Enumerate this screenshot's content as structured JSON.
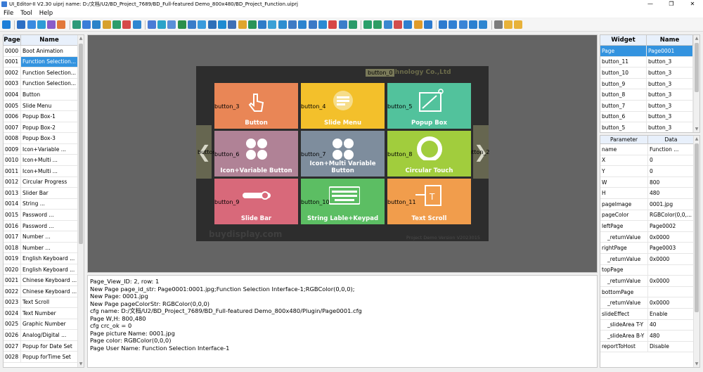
{
  "window": {
    "title": "UI_Editor-II V2.30    uiprj name: D:/文档/U2/BD_Project_7689/BD_Full-featured Demo_800x480/BD_Project_Function.uiprj",
    "minimize": "—",
    "maximize": "❐",
    "close": "✕"
  },
  "menu": [
    "File",
    "Tool",
    "Help"
  ],
  "toolbar": {
    "icons": [
      "search-icon",
      "page-icon",
      "page-add-icon",
      "page-copy-icon",
      "image-icon",
      "color-icon",
      "text-icon",
      "table-icon",
      "grid-icon",
      "grid2-icon",
      "grid3-icon",
      "calendar-icon",
      "save-icon",
      "list-icon",
      "image2-icon",
      "slider-icon",
      "time-icon",
      "keyboard-icon",
      "clock-icon",
      "bell-icon",
      "car-icon",
      "print-icon",
      "chart-icon",
      "menu-icon",
      "circle-icon",
      "wave-icon",
      "globe-icon",
      "compass-icon",
      "picture-icon",
      "mic-icon",
      "timer-icon",
      "video-icon",
      "camera-icon",
      "align-left-icon",
      "align-top-icon",
      "align-bottom-icon",
      "align-right-icon",
      "distribute-icon",
      "align-center-icon",
      "fit-icon",
      "zoom-in-icon",
      "zoom-out-icon",
      "frame-icon",
      "layout-icon",
      "edit-icon",
      "copy-icon",
      "delete-icon",
      "undo-icon",
      "redo-icon"
    ],
    "colors": [
      "#1e7fd8",
      "#2c6fc4",
      "#3a8be0",
      "#2f9bd6",
      "#8a5cc9",
      "#e2783a",
      "#2c9a7a",
      "#3b7dd8",
      "#2a83c9",
      "#d7a12e",
      "#2b9d6b",
      "#d64a4a",
      "#2f86d1",
      "#4a7bd6",
      "#2aa3c9",
      "#5a8fd8",
      "#2b8f4a",
      "#3a7dc9",
      "#3a9bdc",
      "#2d6fb8",
      "#1f8bd1",
      "#3f6fb5",
      "#e0a52c",
      "#2a9458",
      "#2f7cc8",
      "#3aa0d6",
      "#2d8ed0",
      "#3e7bc4",
      "#2b84cf",
      "#3a79c6",
      "#2b8ad3",
      "#d74646",
      "#3a7dc9",
      "#2a9b6a",
      "#2aa06b",
      "#2f9d64",
      "#3a88d0",
      "#d24d4d",
      "#2d7fd0",
      "#e09b2a",
      "#2d7bcf",
      "#2d7bcf",
      "#3180d3",
      "#3a84d6",
      "#2a7fd0",
      "#2f86d1",
      "#7d7d7d",
      "#e8b23a",
      "#e8b23a"
    ]
  },
  "pages": {
    "headers": [
      "Page",
      "Name"
    ],
    "rows": [
      [
        "0000",
        "Boot Animation"
      ],
      [
        "0001",
        "Function Selection..."
      ],
      [
        "0002",
        "Function Selection..."
      ],
      [
        "0003",
        "Function Selection..."
      ],
      [
        "0004",
        "Button"
      ],
      [
        "0005",
        "Slide Menu"
      ],
      [
        "0006",
        "Popup  Box-1"
      ],
      [
        "0007",
        "Popup  Box-2"
      ],
      [
        "0008",
        "Popup  Box-3"
      ],
      [
        "0009",
        "Icon+Variable ..."
      ],
      [
        "0010",
        "Icon+Multi ..."
      ],
      [
        "0011",
        "Icon+Multi ..."
      ],
      [
        "0012",
        "Circular Progress"
      ],
      [
        "0013",
        "Slider Bar"
      ],
      [
        "0014",
        "String ..."
      ],
      [
        "0015",
        "Password ..."
      ],
      [
        "0016",
        "Password ..."
      ],
      [
        "0017",
        "Number ..."
      ],
      [
        "0018",
        "Number ..."
      ],
      [
        "0019",
        "English Keyboard ..."
      ],
      [
        "0020",
        "English Keyboard ..."
      ],
      [
        "0021",
        "Chinese Keyboard ..."
      ],
      [
        "0022",
        "Chinese Keyboard ..."
      ],
      [
        "0023",
        "Text Scroll"
      ],
      [
        "0024",
        "Text Number"
      ],
      [
        "0025",
        "Graphic Number"
      ],
      [
        "0026",
        "Analog/Digital ..."
      ],
      [
        "0027",
        "Popup for Date Set"
      ],
      [
        "0028",
        "Popup forTime Set"
      ]
    ],
    "selected_index": 1
  },
  "preview": {
    "bg_company_text": "sing Technology Co.,Ltd",
    "button_0": "button_0",
    "watermark": "buydisplay.com",
    "version": "Project Demo Version V2023015",
    "left_arrow": "❮",
    "right_arrow": "❯",
    "left_arrow_button": "button_1",
    "right_arrow_button": "button_2",
    "tiles": [
      {
        "button": "button_3",
        "label": "Button",
        "color": "#e98656"
      },
      {
        "button": "button_4",
        "label": "Slide Menu",
        "color": "#f3c02b"
      },
      {
        "button": "button_5",
        "label": "Popup Box",
        "color": "#52c29c"
      },
      {
        "button": "button_6",
        "label": "Icon+Variable Button",
        "color": "#b08296"
      },
      {
        "button": "button_7",
        "label": "Icon+Multi Variable Button",
        "color": "#7e8d9d"
      },
      {
        "button": "button_8",
        "label": "Circular Touch",
        "color": "#a1cd3d"
      },
      {
        "button": "button_9",
        "label": "Slide Bar",
        "color": "#d8697a"
      },
      {
        "button": "button_10",
        "label": "String Lable+Keypad",
        "color": "#5cbe63"
      },
      {
        "button": "button_11",
        "label": "Text Scroll",
        "color": "#f19d4c"
      }
    ]
  },
  "console": [
    "Page_View_ID: 2, row: 1",
    "New Page page_id_str: Page0001:0001.jpg;Function Selection Interface-1;RGBColor(0,0,0);",
    "New Page: 0001.jpg",
    "New Page pageColorStr: RGBColor(0,0,0)",
    "cfg name: D:/文档/U2/BD_Project_7689/BD_Full-featured Demo_800x480/Plugin/Page0001.cfg",
    "Page W,H: 800,480",
    "cfg crc_ok = 0",
    "Page picture Name: 0001.jpg",
    "Page color: RGBColor(0,0,0)",
    "Page User Name: Function Selection Interface-1"
  ],
  "widgets": {
    "headers": [
      "Widget",
      "Name"
    ],
    "rows": [
      [
        "Page",
        "Page0001"
      ],
      [
        "button_11",
        "button_3"
      ],
      [
        "button_10",
        "button_3"
      ],
      [
        "button_9",
        "button_3"
      ],
      [
        "button_8",
        "button_3"
      ],
      [
        "button_7",
        "button_3"
      ],
      [
        "button_6",
        "button_3"
      ],
      [
        "button_5",
        "button_3"
      ]
    ],
    "selected_index": 0
  },
  "params": {
    "headers": [
      "Parameter",
      "Data"
    ],
    "rows": [
      [
        "name",
        "Function ...",
        false
      ],
      [
        "X",
        "0",
        false
      ],
      [
        "Y",
        "0",
        false
      ],
      [
        "W",
        "800",
        false
      ],
      [
        "H",
        "480",
        false
      ],
      [
        "pageImage",
        "0001.jpg",
        false
      ],
      [
        "pageColor",
        "RGBColor(0,0,...",
        false
      ],
      [
        "leftPage",
        "Page0002",
        false
      ],
      [
        "_returnValue",
        "0x0000",
        true
      ],
      [
        "rightPage",
        "Page0003",
        false
      ],
      [
        "_returnValue",
        "0x0000",
        true
      ],
      [
        "topPage",
        "",
        false
      ],
      [
        "_returnValue",
        "0x0000",
        true
      ],
      [
        "bottomPage",
        "",
        false
      ],
      [
        "_returnValue",
        "0x0000",
        true
      ],
      [
        "slideEffect",
        "Enable",
        false
      ],
      [
        "_slideArea T-Y",
        "40",
        true
      ],
      [
        "_slideArea B-Y",
        "480",
        true
      ],
      [
        "reportToHost",
        "Disable",
        false
      ]
    ]
  }
}
